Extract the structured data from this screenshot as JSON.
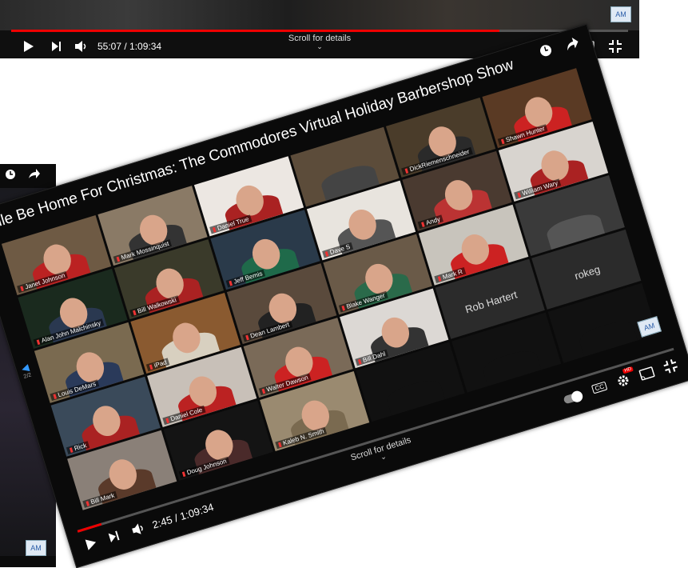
{
  "top_player": {
    "progress_fraction": 0.792,
    "time_display": "55:07 / 1:09:34",
    "scroll_label": "Scroll for details",
    "watermark": "AM"
  },
  "left_player": {
    "watermark": "AM"
  },
  "main_player": {
    "title": "Yule Be Home For Christmas: The Commodores Virtual Holiday Barbershop Show",
    "time_display": "2:45 / 1:09:34",
    "progress_fraction": 0.04,
    "scroll_label": "Scroll for details",
    "side_nav_page": "2/2",
    "watermark": "AM",
    "participants": [
      {
        "name": "Janet Johnson",
        "bg": "#6e5a44",
        "shirt": "#b22"
      },
      {
        "name": "Mark Mossinquist",
        "bg": "#8a7a66",
        "shirt": "#333"
      },
      {
        "name": "Daniel True",
        "bg": "#ece7e2",
        "shirt": "#a22"
      },
      {
        "name": "",
        "bg": "#5c4c3a",
        "shirt": "#444"
      },
      {
        "name": "DickRiemenschneider",
        "bg": "#4a3c2a",
        "shirt": "#2a2a2a"
      },
      {
        "name": "Shawn Hunter",
        "bg": "#5a3a24",
        "shirt": "#c22"
      },
      {
        "name": "Alan John Malchinsky",
        "bg": "#1a2a1e",
        "shirt": "#2a3850"
      },
      {
        "name": "Bill Walkowski",
        "bg": "#3a3a2a",
        "shirt": "#a22"
      },
      {
        "name": "Jeff Bemis",
        "bg": "#2a3a4a",
        "shirt": "#1f6a4a"
      },
      {
        "name": "Dave S",
        "bg": "#e8e4de",
        "shirt": "#555"
      },
      {
        "name": "Andy",
        "bg": "#4a3a30",
        "shirt": "#b33"
      },
      {
        "name": "William Wary",
        "bg": "#d8d4cf",
        "shirt": "#a22"
      },
      {
        "name": "Louis DeMars",
        "bg": "#7a6a50",
        "shirt": "#2a3a5a"
      },
      {
        "name": "iPad",
        "bg": "#8a5a30",
        "shirt": "#d8d0c0"
      },
      {
        "name": "Dean Lambert",
        "bg": "#5a4a3c",
        "shirt": "#222"
      },
      {
        "name": "Blake Wanger",
        "bg": "#6a5a48",
        "shirt": "#2a6a4a"
      },
      {
        "name": "Mark R",
        "bg": "#c8c4bc",
        "shirt": "#c22"
      },
      {
        "name": "",
        "bg": "#3a3a3a",
        "shirt": "#555"
      },
      {
        "name": "Rick",
        "bg": "#3a4a5a",
        "shirt": "#a22"
      },
      {
        "name": "Daniel Cole",
        "bg": "#c8c0b8",
        "shirt": "#b22"
      },
      {
        "name": "Walter Dawson",
        "bg": "#7a6a58",
        "shirt": "#c22"
      },
      {
        "name": "Bill Dahl",
        "bg": "#dcd8d4",
        "shirt": "#333"
      },
      {
        "name": "",
        "bg": "#2b2b2b",
        "empty": true,
        "label": "Rob Hartert"
      },
      {
        "name": "",
        "bg": "#2b2b2b",
        "empty": true,
        "label": "rokeg"
      },
      {
        "name": "Bill Mark",
        "bg": "#8a8078",
        "shirt": "#5a3a2a"
      },
      {
        "name": "Doug Johnson",
        "bg": "#141414",
        "shirt": "#4a2a2a"
      },
      {
        "name": "Kaleb N. Smith",
        "bg": "#9a8a70",
        "shirt": "#7a6a50"
      },
      {
        "name": "",
        "bg": "#111111",
        "shirt": "#111"
      },
      {
        "name": "",
        "bg": "#111111",
        "shirt": "#111"
      },
      {
        "name": "",
        "bg": "#111111",
        "shirt": "#111"
      }
    ]
  }
}
